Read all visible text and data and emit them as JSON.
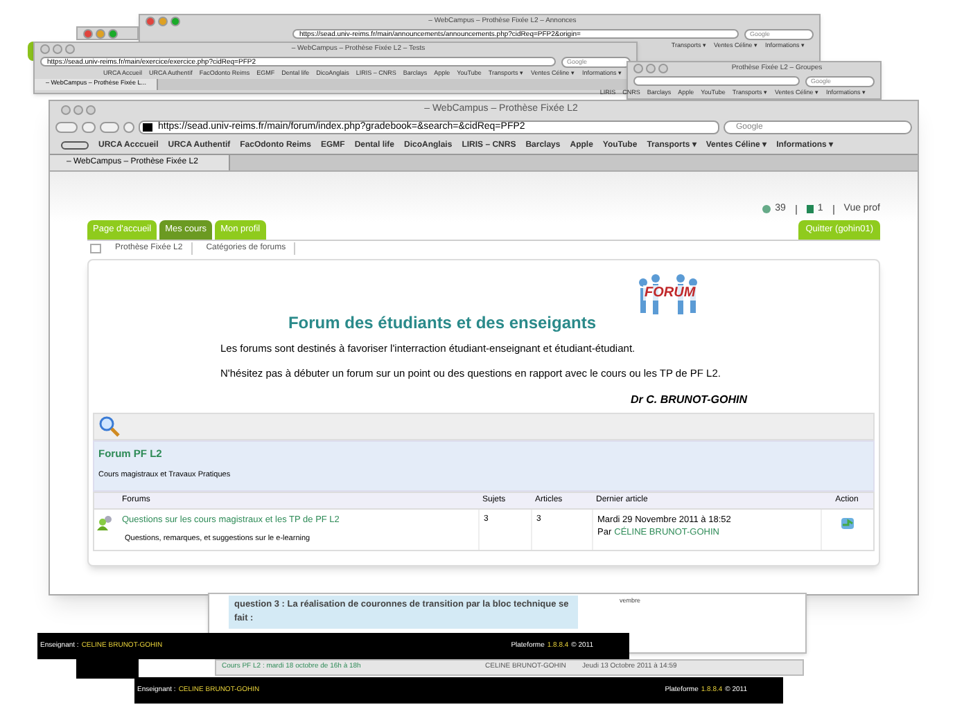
{
  "background_windows": [
    {
      "title": "– WebCampus – Prothèse Fixée L2 – Annonces",
      "url": "https://sead.univ-reims.fr/main/announcements/announcements.php?cidReq=PFP2&origin=",
      "search": {
        "placeholder": "Google"
      },
      "bookmarks": [
        "Transports ▾",
        "Ventes Céline ▾",
        "Informations ▾"
      ]
    },
    {
      "title": "– WebCampus – Prothèse Fixée L2 – Tests",
      "url": "https://sead.univ-reims.fr/main/exercice/exercice.php?cidReq=PFP2",
      "search": {
        "placeholder": "Google"
      },
      "bookmarks": [
        "URCA Accueil",
        "URCA Authentif",
        "FacOdonto Reims",
        "EGMF",
        "Dental life",
        "DicoAnglais",
        "LIRIS – CNRS",
        "Barclays",
        "Apple",
        "YouTube",
        "Transports ▾",
        "Ventes Céline ▾",
        "Informations ▾"
      ],
      "tab": "– WebCampus – Prothèse Fixée L..."
    },
    {
      "title": "Prothèse Fixée L2 – Groupes",
      "search": {
        "placeholder": "Google"
      },
      "bookmarks": [
        "LIRIS",
        "CNRS",
        "Barclays",
        "Apple",
        "YouTube",
        "Transports ▾",
        "Ventes Céline ▾",
        "Informations ▾"
      ]
    }
  ],
  "window": {
    "title": "– WebCampus – Prothèse Fixée L2",
    "url": "https://sead.univ-reims.fr/main/forum/index.php?gradebook=&search=&cidReq=PFP2",
    "search": {
      "placeholder": "Google"
    },
    "bookmarks": [
      "URCA Acccueil",
      "URCA Authentif",
      "FacOdonto Reims",
      "EGMF",
      "Dental life",
      "DicoAnglais",
      "LIRIS – CNRS",
      "Barclays",
      "Apple",
      "YouTube",
      "Transports ▾",
      "Ventes Céline ▾",
      "Informations ▾"
    ],
    "tab": "– WebCampus – Prothèse Fixée L2"
  },
  "status": {
    "users": "39",
    "messages": "1",
    "view": "Vue prof"
  },
  "nav_tabs": [
    {
      "label": "Page d'accueil",
      "selected": false
    },
    {
      "label": "Mes cours",
      "selected": true
    },
    {
      "label": "Mon profil",
      "selected": false
    }
  ],
  "logout": "Quitter (gohin01)",
  "breadcrumb": [
    "Prothèse Fixée L2",
    "Catégories de forums"
  ],
  "intro": {
    "heading": "Forum des étudiants et des enseigants",
    "logo_text": "FORUM",
    "paragraphs": [
      "Les forums sont destinés à favoriser l'interraction étudiant-enseignant et étudiant-étudiant.",
      "N'hésitez pas à débuter un forum sur un point ou des questions en rapport avec le cours ou les TP de PF L2."
    ],
    "signature": "Dr C. BRUNOT-GOHIN"
  },
  "category": {
    "title": "Forum PF L2",
    "description": "Cours magistraux et Travaux Pratiques"
  },
  "table": {
    "columns": [
      "Forums",
      "Sujets",
      "Articles",
      "Dernier article",
      "Action"
    ],
    "rows": [
      {
        "title": "Questions sur les cours magistraux et les TP de PF L2",
        "description": "Questions, remarques, et suggestions sur le e-learning",
        "topics": "3",
        "articles": "3",
        "last_date": "Mardi 29 Novembre 2011 à 18:52",
        "last_by_prefix": "Par",
        "last_by": "CÉLINE BRUNOT-GOHIN"
      }
    ]
  },
  "lower_windows": {
    "question": "question 3 : La réalisation de couronnes de transition par la bloc technique se fait :",
    "fragment": "vembre",
    "row": {
      "title": "Cours PF L2 : mardi 18 octobre de 16h à 18h",
      "author": "CELINE BRUNOT-GOHIN",
      "date": "Jeudi 13 Octobre 2011 à 14:59"
    },
    "footers": [
      {
        "role": "Enseignant :",
        "name": "CELINE BRUNOT-GOHIN",
        "platform": "Plateforme",
        "version": "1.8.8.4",
        "year": "© 2011"
      },
      {
        "role": "Enseignant :",
        "name": "CELINE BRUNOT-GOHIN",
        "platform": "Plateforme",
        "version": "1.8.8.4",
        "year": "© 2011"
      }
    ]
  }
}
